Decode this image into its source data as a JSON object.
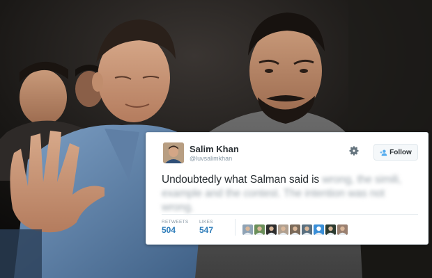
{
  "tweet": {
    "display_name": "Salim Khan",
    "handle": "@luvsalimkhan",
    "follow_label": "Follow",
    "text_visible": "Undoubtedly what Salman said is",
    "text_blurred": "wrong, the simili, example and the contest. The intention was not wrong.",
    "stats": [
      {
        "label": "RETWEETS",
        "value": "504"
      },
      {
        "label": "LIKES",
        "value": "547"
      }
    ],
    "liker_avatars": [
      "#8fa3b5",
      "#6b8f5a",
      "#2d2d2d",
      "#b0a090",
      "#7a6a5a",
      "#5a7080",
      "#3a8fd8",
      "#2b3a2f",
      "#9a8070"
    ]
  },
  "colors": {
    "accent": "#55acee",
    "stat_value": "#2b7bb9",
    "text": "#292f33",
    "muted": "#8899a6"
  },
  "icons": {
    "gear": "gear-icon",
    "follow": "add-user-icon"
  }
}
